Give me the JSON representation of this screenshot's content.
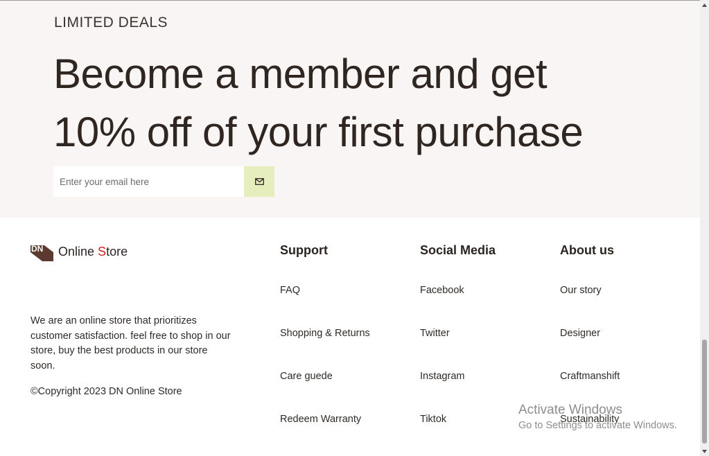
{
  "deals": {
    "eyebrow": "LIMITED DEALS",
    "headline_line1": "Become a member and get",
    "headline_line2": "10% off of your first purchase",
    "email_placeholder": "Enter your email here",
    "submit_icon": "mail-icon",
    "submit_color": "#e6eebd"
  },
  "footer": {
    "brand": {
      "logo_letters": "DN",
      "name_part1": "Online ",
      "name_accent": "S",
      "name_part2": "tore",
      "accent_color": "#d11f1f"
    },
    "about": "We are an online store that prioritizes customer satisfaction. feel free to shop in our store, buy the best products in our store soon.",
    "copyright": "©Copyright 2023 DN Online Store",
    "columns": [
      {
        "heading": "Support",
        "links": [
          "FAQ",
          "Shopping & Returns",
          "Care guede",
          "Redeem Warranty"
        ]
      },
      {
        "heading": "Social Media",
        "links": [
          "Facebook",
          "Twitter",
          "Instagram",
          "Tiktok"
        ]
      },
      {
        "heading": "About us",
        "links": [
          "Our story",
          "Designer",
          "Craftmanshift",
          "Sustainability"
        ]
      }
    ]
  },
  "watermark": {
    "title": "Activate Windows",
    "subtitle": "Go to Settings to activate Windows."
  }
}
